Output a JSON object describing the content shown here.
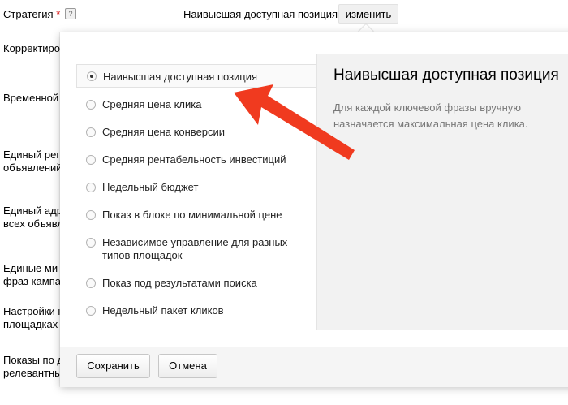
{
  "background": {
    "strategy_label": "Стратегия",
    "required_mark": "*",
    "help_mark": "?",
    "strategy_value": "Наивысшая доступная позиция",
    "change_button": "изменить",
    "labels": [
      "Корректиро",
      "Временной",
      "Единый рег",
      "объявлений",
      "Единый адр",
      "всех объявл",
      "Единые ми",
      "фраз кампа",
      "Настройки н",
      "площадках",
      "Показы по д",
      "релевантны"
    ]
  },
  "popup": {
    "options": [
      {
        "label": "Наивысшая доступная позиция",
        "selected": true
      },
      {
        "label": "Средняя цена клика",
        "selected": false
      },
      {
        "label": "Средняя цена конверсии",
        "selected": false
      },
      {
        "label": "Средняя рентабельность инвестиций",
        "selected": false
      },
      {
        "label": "Недельный бюджет",
        "selected": false
      },
      {
        "label": "Показ в блоке по минимальной цене",
        "selected": false
      },
      {
        "label": "Независимое управление для разных типов площадок",
        "selected": false
      },
      {
        "label": "Показ под результатами поиска",
        "selected": false
      },
      {
        "label": "Недельный пакет кликов",
        "selected": false
      }
    ],
    "detail": {
      "title": "Наивысшая доступная позиция",
      "description": "Для каждой ключевой фразы вручную назначается максимальная цена клика."
    },
    "footer": {
      "save_button": "Сохранить",
      "cancel_button": "Отмена"
    }
  },
  "colors": {
    "annotation_arrow": "#f03a1f",
    "description_text": "#777777",
    "detail_background": "#f2f2f2"
  }
}
